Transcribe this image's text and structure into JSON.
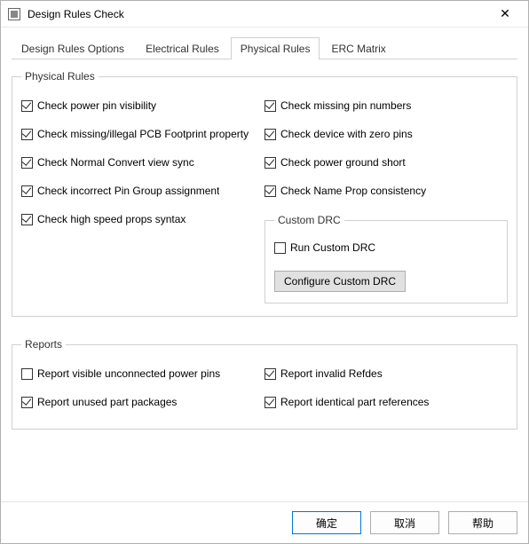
{
  "window": {
    "title": "Design Rules Check"
  },
  "tabs": {
    "design_options": "Design Rules Options",
    "electrical": "Electrical Rules",
    "physical": "Physical Rules",
    "erc": "ERC Matrix"
  },
  "physical": {
    "legend": "Physical Rules",
    "left": {
      "power_pin_visibility": "Check power pin visibility",
      "missing_footprint": "Check missing/illegal PCB Footprint property",
      "normal_convert": "Check Normal Convert view sync",
      "pin_group": "Check incorrect Pin Group assignment",
      "high_speed": "Check high speed props syntax"
    },
    "right": {
      "missing_pin_numbers": "Check missing pin numbers",
      "zero_pins": "Check device with zero pins",
      "power_ground_short": "Check power ground short",
      "name_prop": "Check Name Prop consistency"
    }
  },
  "custom_drc": {
    "legend": "Custom DRC",
    "run": "Run Custom DRC",
    "configure": "Configure Custom DRC"
  },
  "reports": {
    "legend": "Reports",
    "left": {
      "visible_unconnected": "Report visible unconnected power pins",
      "unused_packages": "Report unused part packages"
    },
    "right": {
      "invalid_refdes": "Report invalid Refdes",
      "identical_refs": "Report identical part references"
    }
  },
  "buttons": {
    "ok": "确定",
    "cancel": "取消",
    "help": "帮助"
  }
}
